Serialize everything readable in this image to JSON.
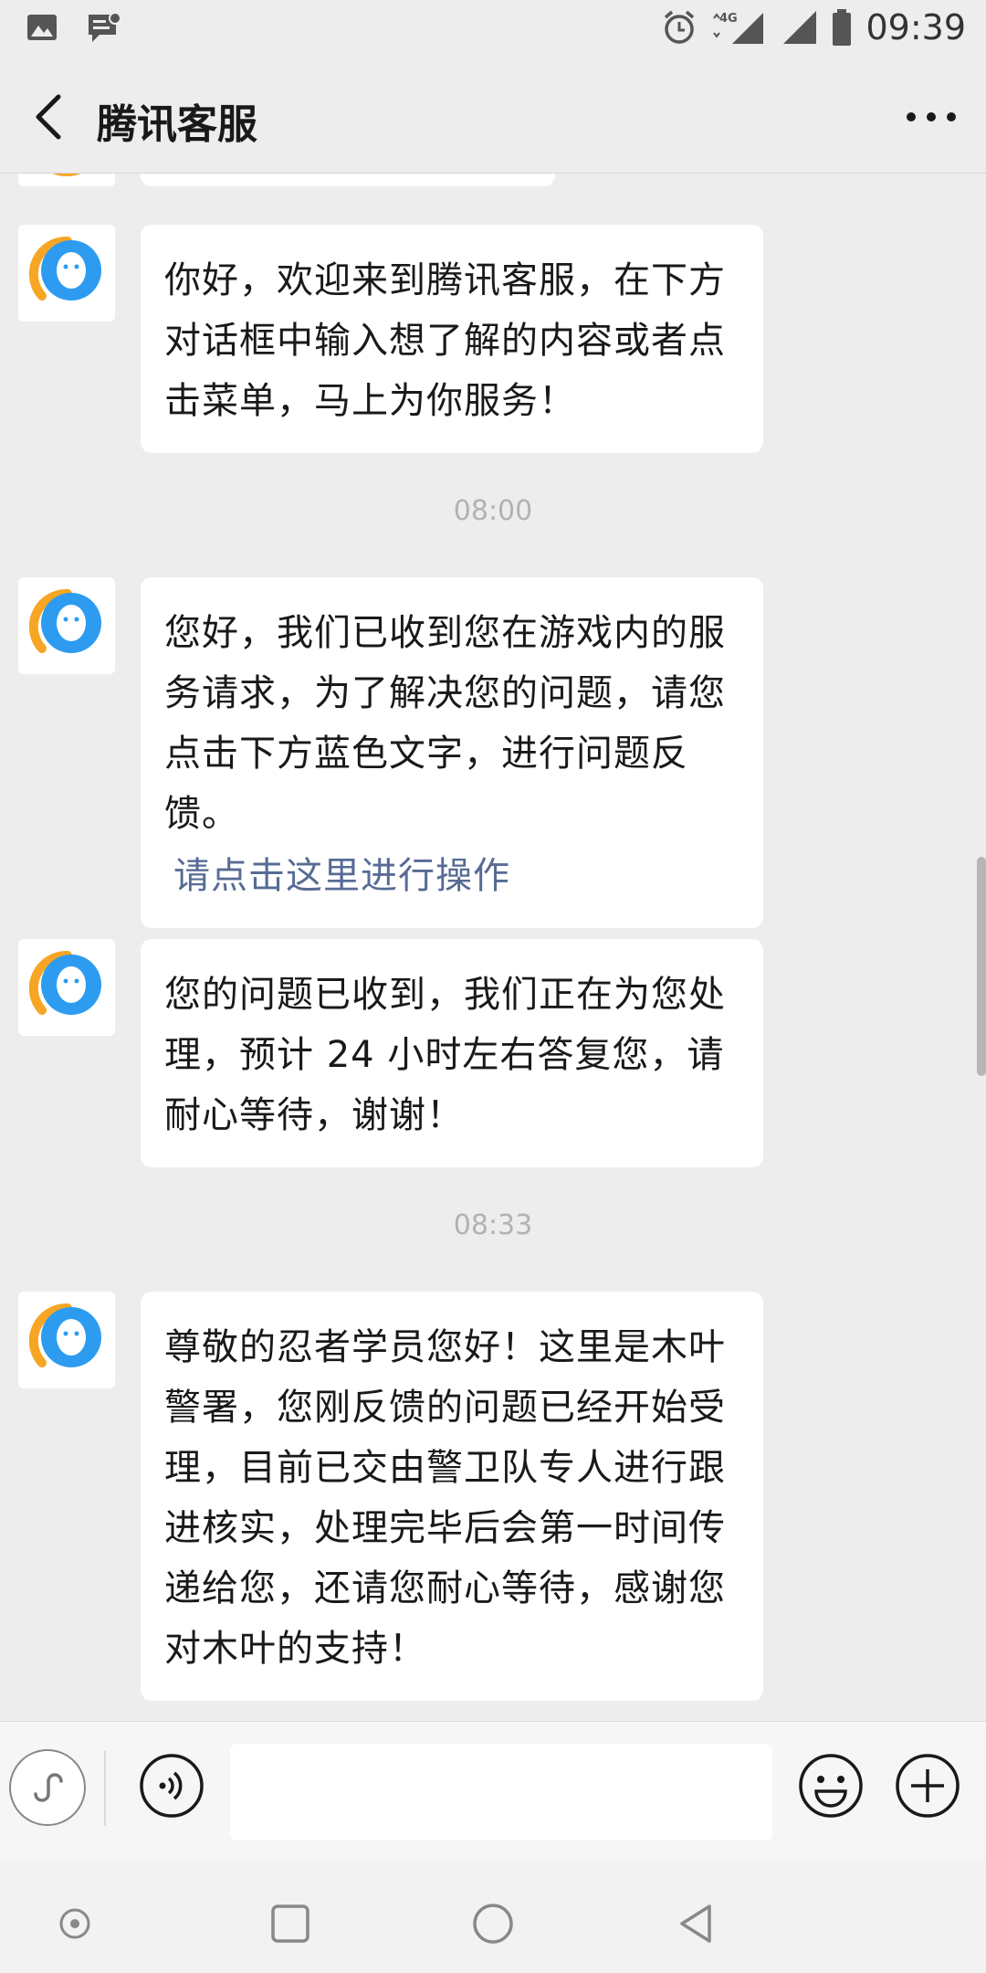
{
  "status_bar": {
    "time": "09:39",
    "network": "4G"
  },
  "header": {
    "title": "腾讯客服"
  },
  "messages": [
    {
      "text": "你好，欢迎来到腾讯客服，在下方对话框中输入想了解的内容或者点击菜单，马上为你服务！"
    },
    {
      "timestamp": "08:00",
      "text": "您好，我们已收到您在游戏内的服务请求，为了解决您的问题，请您点击下方蓝色文字，进行问题反馈。",
      "link": "请点击这里进行操作"
    },
    {
      "text": "您的问题已收到，我们正在为您处理，预计 24 小时左右答复您，请耐心等待，谢谢！"
    },
    {
      "timestamp": "08:33",
      "text": "尊敬的忍者学员您好！这里是木叶警署，您刚反馈的问题已经开始受理，目前已交由警卫队专人进行跟进核实，处理完毕后会第一时间传递给您，还请您耐心等待，感谢您对木叶的支持！"
    }
  ],
  "input": {
    "placeholder": ""
  },
  "colors": {
    "link": "#576b95",
    "background": "#ededed",
    "bubble": "#ffffff",
    "avatar_blue": "#2d9cf0",
    "avatar_orange": "#f7a524"
  },
  "icons": {
    "mini_program": "mini-program-icon",
    "voice": "voice-icon",
    "emoji": "emoji-icon",
    "plus": "plus-icon"
  }
}
